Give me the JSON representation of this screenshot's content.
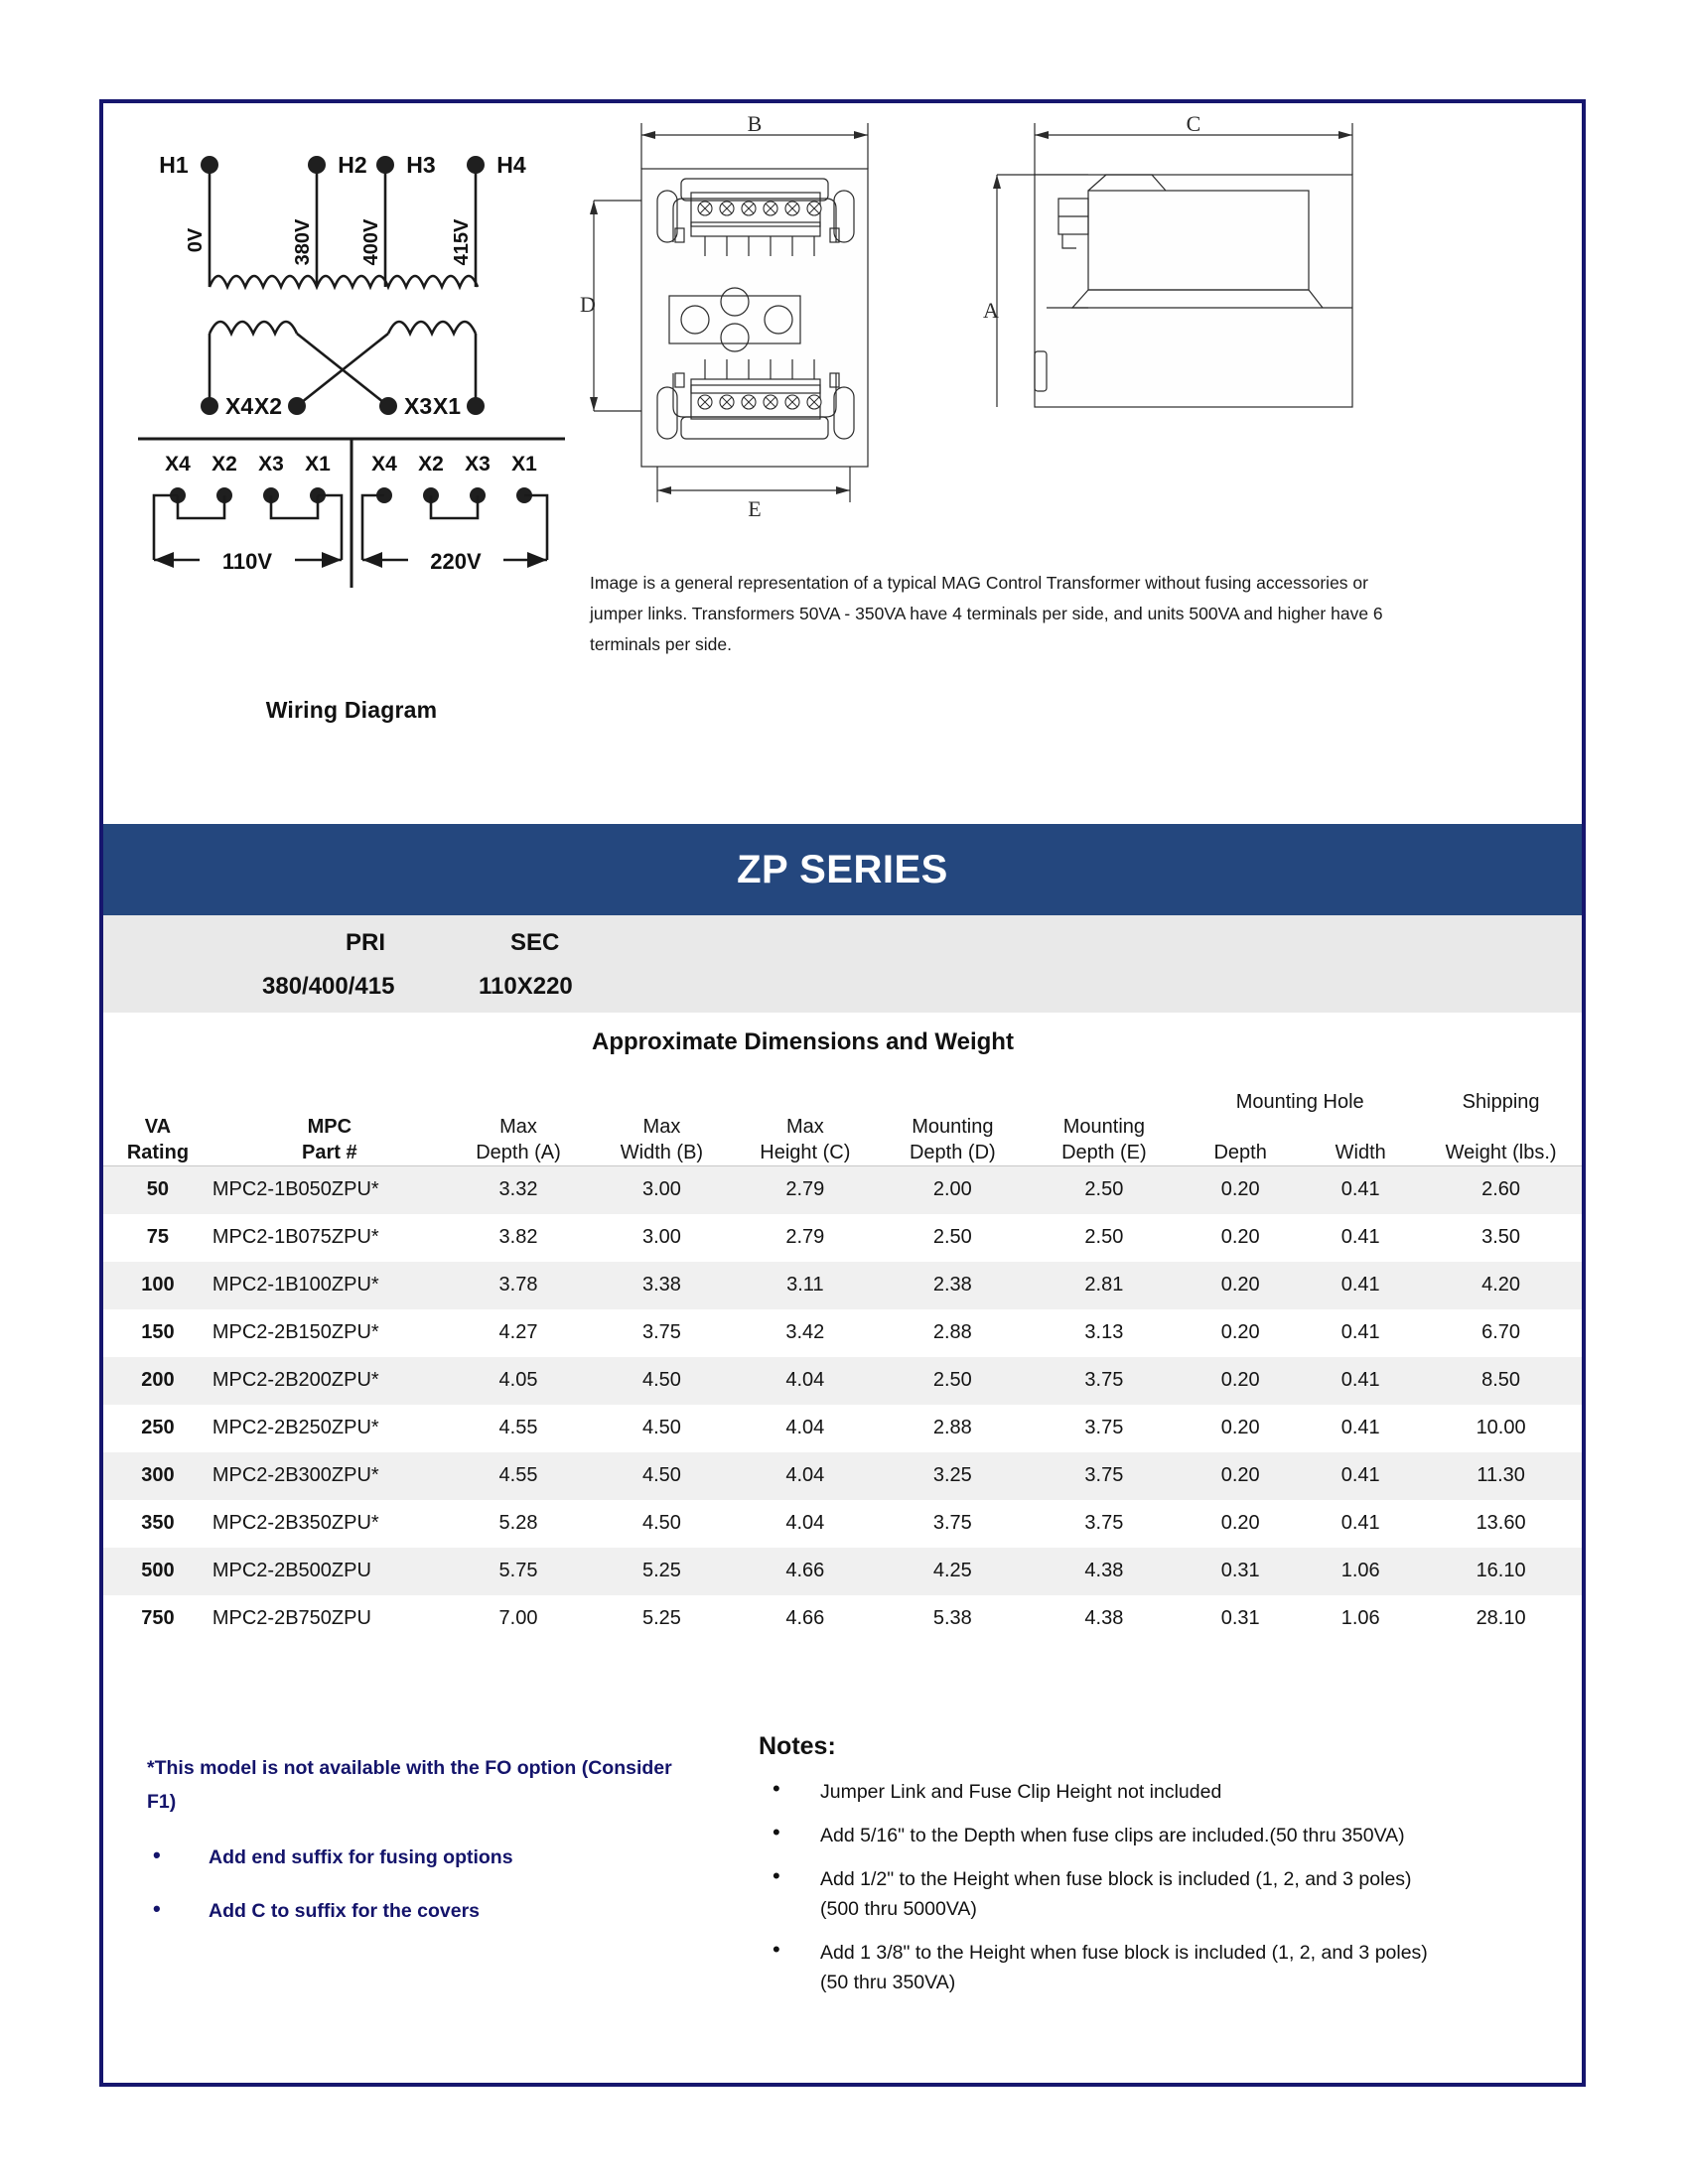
{
  "wiring_diagram": {
    "caption": "Wiring Diagram",
    "primary_terminals": [
      "H1",
      "H2",
      "H3",
      "H4"
    ],
    "primary_voltages": [
      "0V",
      "380V",
      "400V",
      "415V"
    ],
    "secondary_terminals": [
      "X4",
      "X2",
      "X3",
      "X1"
    ],
    "connection_groups": [
      {
        "label": "110V",
        "terminals": [
          "X4",
          "X2",
          "X3",
          "X1"
        ]
      },
      {
        "label": "220V",
        "terminals": [
          "X4",
          "X2",
          "X3",
          "X1"
        ]
      }
    ]
  },
  "drawings": {
    "front_view_dim_width": "B",
    "front_view_dim_height": "D",
    "front_view_dim_bottom": "E",
    "side_view_dim_width": "C",
    "side_view_dim_height": "A"
  },
  "image_note": "Image is a general representation of a typical MAG Control Transformer without fusing accessories or jumper links.  Transformers 50VA - 350VA  have 4 terminals per side, and units 500VA and higher have 6 terminals per side.",
  "banner": {
    "title": "ZP SERIES",
    "color": "#24477e"
  },
  "pri_sec": {
    "pri_label": "PRI",
    "sec_label": "SEC",
    "pri_value": "380/400/415",
    "sec_value": "110X220"
  },
  "table": {
    "subtitle": "Approximate Dimensions and Weight",
    "group_headers": {
      "mounting_hole": "Mounting Hole",
      "shipping": "Shipping"
    },
    "headers": {
      "va_line1": "VA",
      "va_line2": "Rating",
      "part_line1": "MPC",
      "part_line2": "Part #",
      "depth_a_line1": "Max",
      "depth_a_line2": "Depth (A)",
      "width_b_line1": "Max",
      "width_b_line2": "Width (B)",
      "height_c_line1": "Max",
      "height_c_line2": "Height (C)",
      "mount_d_line1": "Mounting",
      "mount_d_line2": "Depth (D)",
      "mount_e_line1": "Mounting",
      "mount_e_line2": "Depth (E)",
      "hole_depth": "Depth",
      "hole_width": "Width",
      "weight": "Weight (lbs.)"
    },
    "rows": [
      {
        "va": "50",
        "part": "MPC2-1B050ZPU*",
        "a": "3.32",
        "b": "3.00",
        "c": "2.79",
        "d": "2.00",
        "e": "2.50",
        "hd": "0.20",
        "hw": "0.41",
        "wt": "2.60"
      },
      {
        "va": "75",
        "part": "MPC2-1B075ZPU*",
        "a": "3.82",
        "b": "3.00",
        "c": "2.79",
        "d": "2.50",
        "e": "2.50",
        "hd": "0.20",
        "hw": "0.41",
        "wt": "3.50"
      },
      {
        "va": "100",
        "part": "MPC2-1B100ZPU*",
        "a": "3.78",
        "b": "3.38",
        "c": "3.11",
        "d": "2.38",
        "e": "2.81",
        "hd": "0.20",
        "hw": "0.41",
        "wt": "4.20"
      },
      {
        "va": "150",
        "part": "MPC2-2B150ZPU*",
        "a": "4.27",
        "b": "3.75",
        "c": "3.42",
        "d": "2.88",
        "e": "3.13",
        "hd": "0.20",
        "hw": "0.41",
        "wt": "6.70"
      },
      {
        "va": "200",
        "part": "MPC2-2B200ZPU*",
        "a": "4.05",
        "b": "4.50",
        "c": "4.04",
        "d": "2.50",
        "e": "3.75",
        "hd": "0.20",
        "hw": "0.41",
        "wt": "8.50"
      },
      {
        "va": "250",
        "part": "MPC2-2B250ZPU*",
        "a": "4.55",
        "b": "4.50",
        "c": "4.04",
        "d": "2.88",
        "e": "3.75",
        "hd": "0.20",
        "hw": "0.41",
        "wt": "10.00"
      },
      {
        "va": "300",
        "part": "MPC2-2B300ZPU*",
        "a": "4.55",
        "b": "4.50",
        "c": "4.04",
        "d": "3.25",
        "e": "3.75",
        "hd": "0.20",
        "hw": "0.41",
        "wt": "11.30"
      },
      {
        "va": "350",
        "part": "MPC2-2B350ZPU*",
        "a": "5.28",
        "b": "4.50",
        "c": "4.04",
        "d": "3.75",
        "e": "3.75",
        "hd": "0.20",
        "hw": "0.41",
        "wt": "13.60"
      },
      {
        "va": "500",
        "part": "MPC2-2B500ZPU",
        "a": "5.75",
        "b": "5.25",
        "c": "4.66",
        "d": "4.25",
        "e": "4.38",
        "hd": "0.31",
        "hw": "1.06",
        "wt": "16.10"
      },
      {
        "va": "750",
        "part": "MPC2-2B750ZPU",
        "a": "7.00",
        "b": "5.25",
        "c": "4.66",
        "d": "5.38",
        "e": "4.38",
        "hd": "0.31",
        "hw": "1.06",
        "wt": "28.10"
      }
    ]
  },
  "footnotes": {
    "star_note": "*This model is not available with the FO option (Consider F1)",
    "items": [
      "Add end suffix for fusing options",
      "Add C to suffix for the covers"
    ],
    "color": "#14146b"
  },
  "notes": {
    "title": "Notes:",
    "items": [
      {
        "main": "Jumper Link and Fuse Clip Height not included",
        "sub": ""
      },
      {
        "main": "Add 5/16\" to the Depth when fuse clips are included.(50 thru 350VA)",
        "sub": ""
      },
      {
        "main": "Add 1/2\" to the Height when fuse block is included (1, 2, and 3 poles)",
        "sub": "(500 thru 5000VA)"
      },
      {
        "main": "Add 1 3/8\" to the Height when fuse block is included (1, 2, and 3 poles)",
        "sub": "(50 thru 350VA)"
      }
    ]
  }
}
